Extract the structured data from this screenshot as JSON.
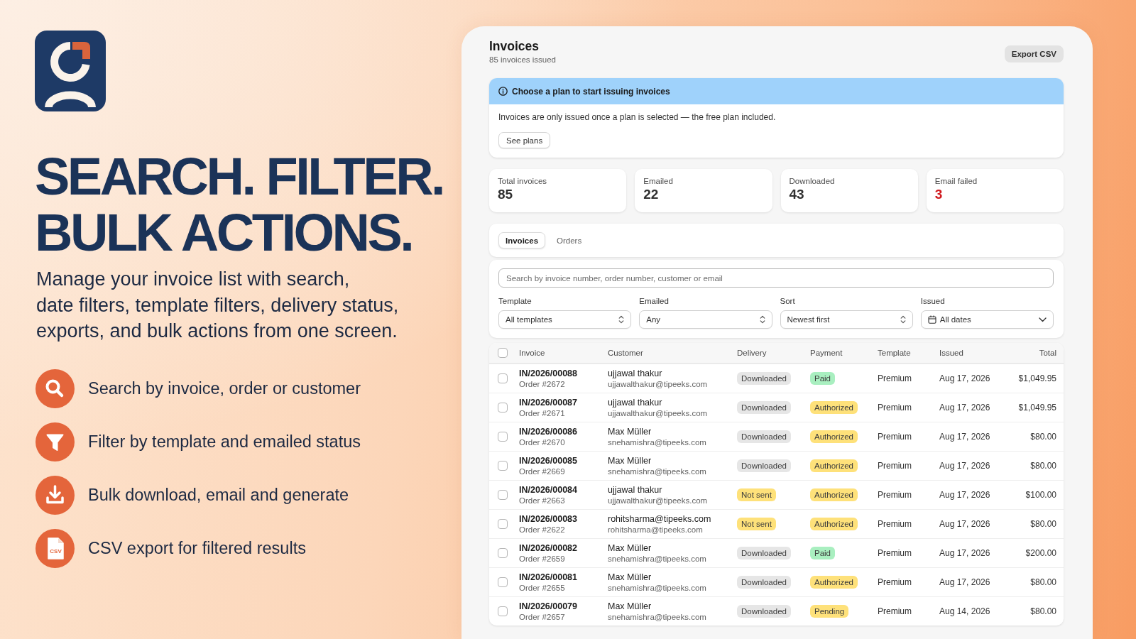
{
  "brand": {
    "headline": "SEARCH. FILTER.\nBULK ACTIONS.",
    "description": "Manage your invoice list with search,\ndate filters, template filters, delivery status,\nexports, and bulk actions from one screen."
  },
  "features": [
    {
      "kind": "search",
      "text": "Search by invoice, order or customer"
    },
    {
      "kind": "filter",
      "text": "Filter by template and emailed status"
    },
    {
      "kind": "download",
      "text": "Bulk download, email and generate"
    },
    {
      "kind": "file",
      "icon_label": "CSV",
      "text": "CSV export for filtered results"
    }
  ],
  "page": {
    "title": "Invoices",
    "subtitle": "85 invoices issued",
    "export_button": "Export CSV"
  },
  "banner": {
    "title": "Choose a plan to start issuing invoices",
    "message": "Invoices are only issued once a plan is selected — the free plan included.",
    "button": "See plans"
  },
  "stats": [
    {
      "label": "Total invoices",
      "value": "85",
      "alert": false
    },
    {
      "label": "Emailed",
      "value": "22",
      "alert": false
    },
    {
      "label": "Downloaded",
      "value": "43",
      "alert": false
    },
    {
      "label": "Email failed",
      "value": "3",
      "alert": true
    }
  ],
  "tabs": [
    {
      "label": "Invoices",
      "selected": true
    },
    {
      "label": "Orders",
      "selected": false
    }
  ],
  "search": {
    "placeholder": "Search by invoice number, order number, customer or email"
  },
  "filters": [
    {
      "label": "Template",
      "value": "All templates",
      "kind": "select"
    },
    {
      "label": "Emailed",
      "value": "Any",
      "kind": "select"
    },
    {
      "label": "Sort",
      "value": "Newest first",
      "kind": "select"
    },
    {
      "label": "Issued",
      "value": "All dates",
      "kind": "date"
    }
  ],
  "table": {
    "select_all_checked": false,
    "columns": [
      "Invoice",
      "Customer",
      "Delivery",
      "Payment",
      "Template",
      "Issued",
      "Total"
    ],
    "rows": [
      {
        "selected": false,
        "invoice": "IN/2026/00088",
        "order": "Order #2672",
        "customer": "ujjawal thakur",
        "email": "ujjawalthakur@tipeeks.com",
        "delivery": {
          "label": "Downloaded",
          "color": "#e6e6e6"
        },
        "payment": {
          "label": "Paid",
          "color": "#a9efc0"
        },
        "template": "Premium",
        "issued": "Aug 17, 2026",
        "total": "$1,049.95"
      },
      {
        "selected": false,
        "invoice": "IN/2026/00087",
        "order": "Order #2671",
        "customer": "ujjawal thakur",
        "email": "ujjawalthakur@tipeeks.com",
        "delivery": {
          "label": "Downloaded",
          "color": "#e6e6e6"
        },
        "payment": {
          "label": "Authorized",
          "color": "#fee17a"
        },
        "template": "Premium",
        "issued": "Aug 17, 2026",
        "total": "$1,049.95"
      },
      {
        "selected": false,
        "invoice": "IN/2026/00086",
        "order": "Order #2670",
        "customer": "Max Müller",
        "email": "snehamishra@tipeeks.com",
        "delivery": {
          "label": "Downloaded",
          "color": "#e6e6e6"
        },
        "payment": {
          "label": "Authorized",
          "color": "#fee17a"
        },
        "template": "Premium",
        "issued": "Aug 17, 2026",
        "total": "$80.00"
      },
      {
        "selected": false,
        "invoice": "IN/2026/00085",
        "order": "Order #2669",
        "customer": "Max Müller",
        "email": "snehamishra@tipeeks.com",
        "delivery": {
          "label": "Downloaded",
          "color": "#e6e6e6"
        },
        "payment": {
          "label": "Authorized",
          "color": "#fee17a"
        },
        "template": "Premium",
        "issued": "Aug 17, 2026",
        "total": "$80.00"
      },
      {
        "selected": false,
        "invoice": "IN/2026/00084",
        "order": "Order #2663",
        "customer": "ujjawal thakur",
        "email": "ujjawalthakur@tipeeks.com",
        "delivery": {
          "label": "Not sent",
          "color": "#fee17a"
        },
        "payment": {
          "label": "Authorized",
          "color": "#fee17a"
        },
        "template": "Premium",
        "issued": "Aug 17, 2026",
        "total": "$100.00"
      },
      {
        "selected": false,
        "invoice": "IN/2026/00083",
        "order": "Order #2622",
        "customer": "rohitsharma@tipeeks.com",
        "email": "rohitsharma@tipeeks.com",
        "delivery": {
          "label": "Not sent",
          "color": "#fee17a"
        },
        "payment": {
          "label": "Authorized",
          "color": "#fee17a"
        },
        "template": "Premium",
        "issued": "Aug 17, 2026",
        "total": "$80.00"
      },
      {
        "selected": false,
        "invoice": "IN/2026/00082",
        "order": "Order #2659",
        "customer": "Max Müller",
        "email": "snehamishra@tipeeks.com",
        "delivery": {
          "label": "Downloaded",
          "color": "#e6e6e6"
        },
        "payment": {
          "label": "Paid",
          "color": "#a9efc0"
        },
        "template": "Premium",
        "issued": "Aug 17, 2026",
        "total": "$200.00"
      },
      {
        "selected": false,
        "invoice": "IN/2026/00081",
        "order": "Order #2655",
        "customer": "Max Müller",
        "email": "snehamishra@tipeeks.com",
        "delivery": {
          "label": "Downloaded",
          "color": "#e6e6e6"
        },
        "payment": {
          "label": "Authorized",
          "color": "#fee17a"
        },
        "template": "Premium",
        "issued": "Aug 17, 2026",
        "total": "$80.00"
      },
      {
        "selected": false,
        "invoice": "IN/2026/00079",
        "order": "Order #2657",
        "customer": "Max Müller",
        "email": "snehamishra@tipeeks.com",
        "delivery": {
          "label": "Downloaded",
          "color": "#e6e6e6"
        },
        "payment": {
          "label": "Pending",
          "color": "#fee17a"
        },
        "template": "Premium",
        "issued": "Aug 14, 2026",
        "total": "$80.00"
      }
    ]
  }
}
